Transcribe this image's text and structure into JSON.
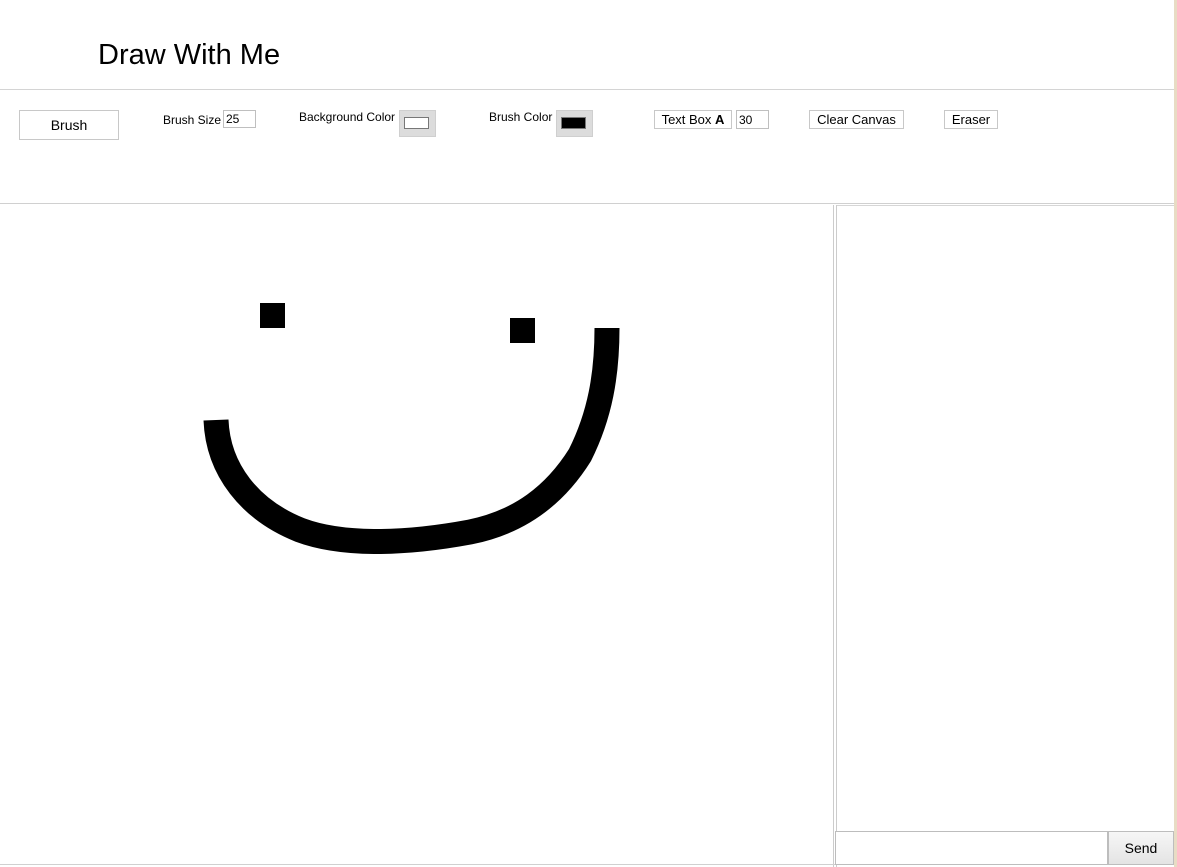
{
  "header": {
    "title": "Draw With Me"
  },
  "toolbar": {
    "brush_label": "Brush",
    "brush_size_label": "Brush Size",
    "brush_size_value": "25",
    "background_color_label": "Background Color",
    "background_color": "#ffffff",
    "brush_color_label": "Brush Color",
    "brush_color": "#000000",
    "text_box_label": "Text Box",
    "text_box_bold_glyph": "A",
    "text_size_value": "30",
    "clear_canvas_label": "Clear Canvas",
    "eraser_label": "Eraser"
  },
  "chat": {
    "input_value": "",
    "send_label": "Send"
  },
  "colors": {
    "stroke": "#000000",
    "border": "#c8c8c8"
  }
}
